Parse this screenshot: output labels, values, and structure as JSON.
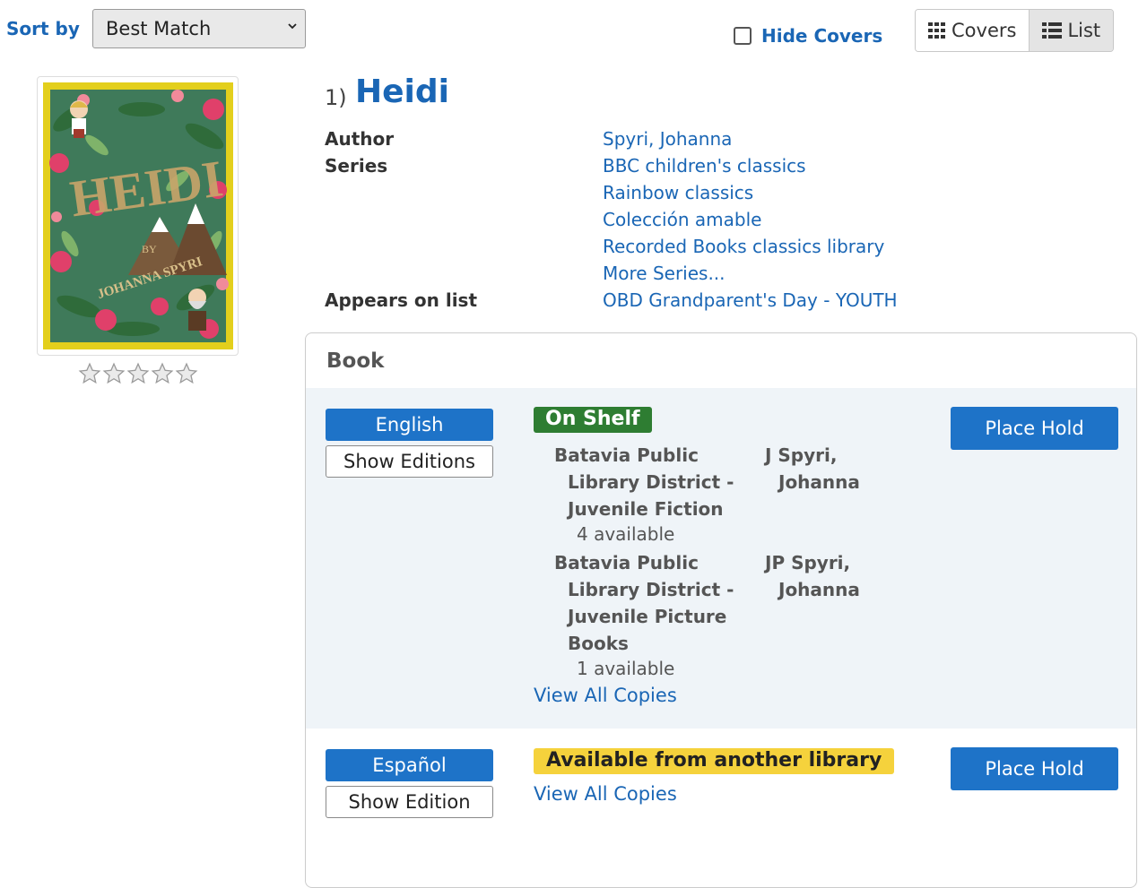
{
  "toolbar": {
    "sort_label": "Sort by",
    "sort_selected": "Best Match",
    "hide_covers_label": "Hide Covers",
    "view_covers_label": "Covers",
    "view_list_label": "List"
  },
  "result": {
    "number": "1)",
    "title": "Heidi",
    "cover_title_text": "HEIDI",
    "cover_by_text": "BY",
    "cover_author_text": "JOHANNA SPYRI",
    "rating_stars": 0,
    "rating_max": 5,
    "meta": {
      "author_label": "Author",
      "author_value": "Spyri, Johanna",
      "series_label": "Series",
      "series_values": [
        "BBC children's classics",
        "Rainbow classics",
        "Colección amable",
        "Recorded Books classics library",
        "More Series..."
      ],
      "list_label": "Appears on list",
      "list_value": "OBD Grandparent's Day - YOUTH"
    }
  },
  "format_panel": {
    "heading": "Book",
    "editions": [
      {
        "language": "English",
        "editions_button": "Show Editions",
        "status": "On Shelf",
        "locations": [
          {
            "line1": "Batavia Public",
            "line2": "Library District -",
            "line3": "Juvenile Fiction",
            "call1": "J Spyri,",
            "call2": "Johanna",
            "available": "4 available"
          },
          {
            "line1": "Batavia Public",
            "line2": "Library District -",
            "line3": "Juvenile Picture",
            "line4": "Books",
            "call1": "JP Spyri,",
            "call2": "Johanna",
            "available": "1 available"
          }
        ],
        "view_all": "View All Copies",
        "hold_button": "Place Hold"
      },
      {
        "language": "Español",
        "editions_button": "Show Edition",
        "status": "Available from another library",
        "view_all": "View All Copies",
        "hold_button": "Place Hold"
      }
    ]
  },
  "colors": {
    "link": "#1a66b5",
    "primary_button": "#1e73c8",
    "on_shelf": "#2e7d32",
    "other_library": "#f5d23c"
  }
}
